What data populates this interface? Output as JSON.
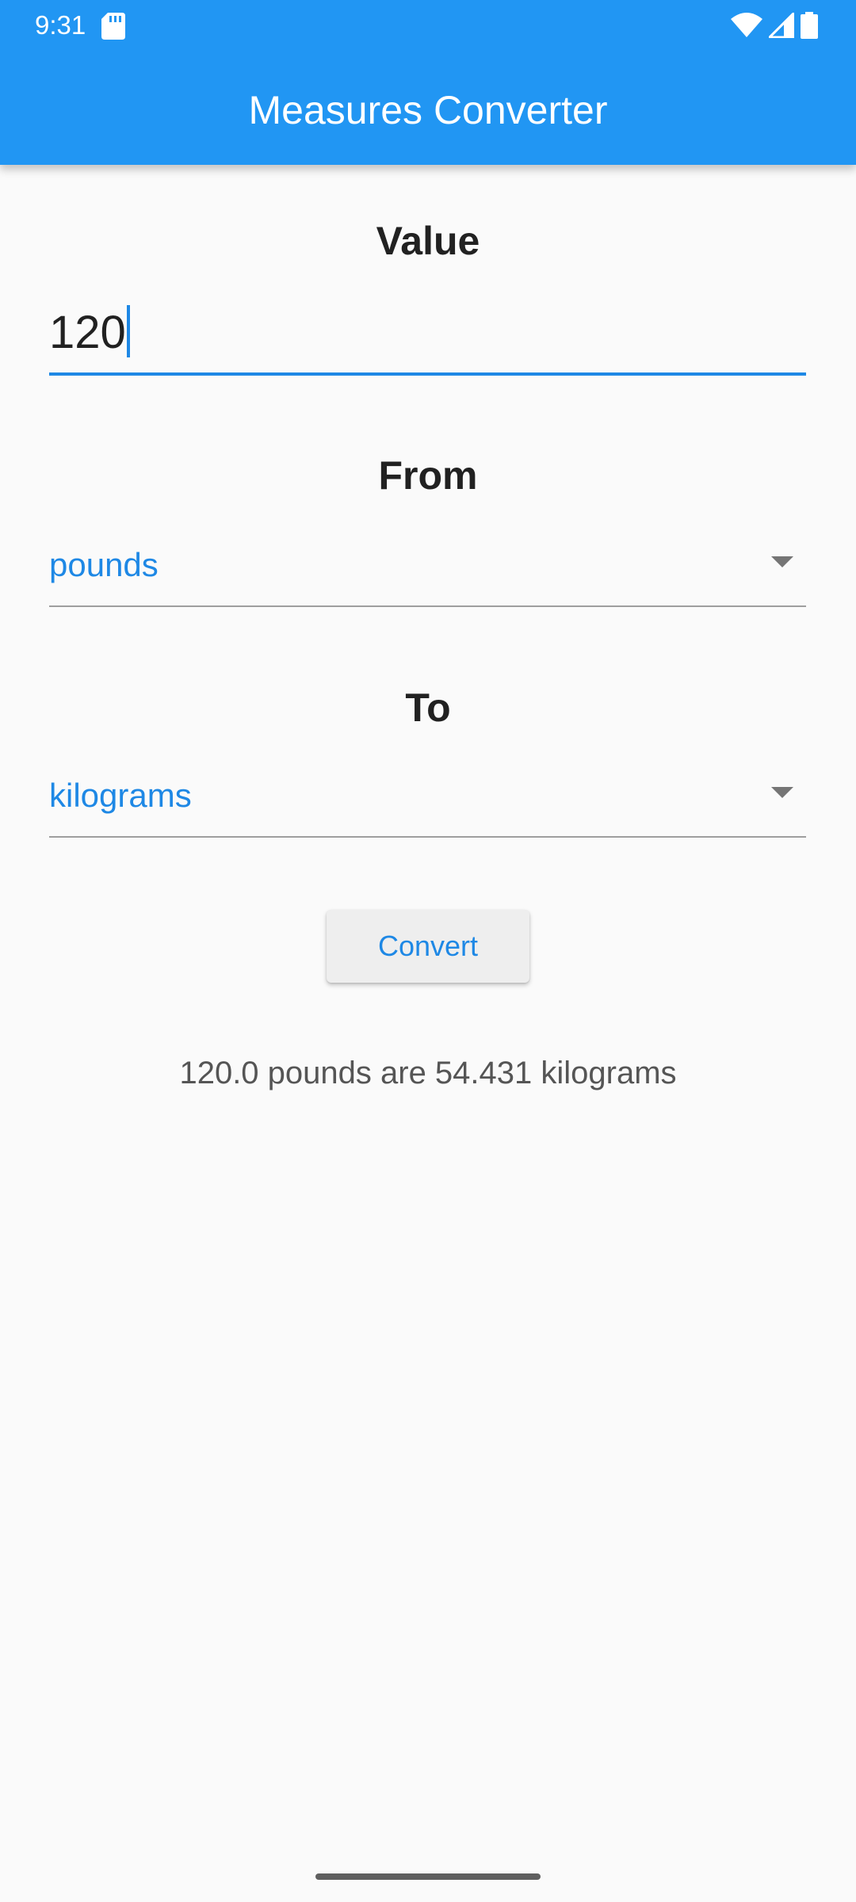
{
  "status_bar": {
    "time": "9:31",
    "icons": [
      "sd-card-icon",
      "wifi-icon",
      "cell-signal-icon",
      "battery-icon"
    ]
  },
  "app_bar": {
    "title": "Measures Converter",
    "color": "#2196f3"
  },
  "value_section": {
    "label": "Value",
    "input_value": "120"
  },
  "from_section": {
    "label": "From",
    "selected": "pounds"
  },
  "to_section": {
    "label": "To",
    "selected": "kilograms"
  },
  "convert_button": {
    "label": "Convert"
  },
  "result_text": "120.0 pounds are 54.431 kilograms",
  "colors": {
    "accent": "#1e88e5",
    "background": "#fafafa"
  }
}
